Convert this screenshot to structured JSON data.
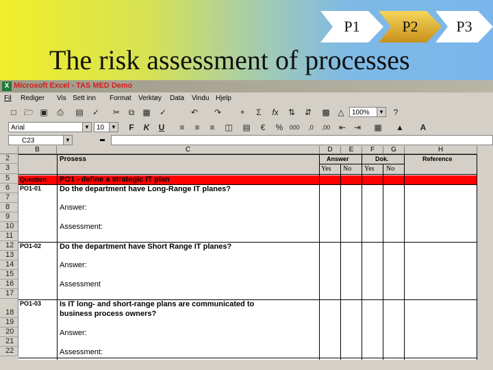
{
  "slide": {
    "title": "The risk assessment of processes",
    "steps": [
      "P1",
      "P2",
      "P3"
    ],
    "colors": {
      "chevron_plain": "#ffffff",
      "chevron_active": "#e8b82a",
      "highlight_row": "#ff0000"
    }
  },
  "excel": {
    "window_title": "Microsoft Excel - TAS MED  Demo",
    "menu": [
      "Fil",
      "Rediger",
      "Vis",
      "Sett inn",
      "Format",
      "Verktøy",
      "Data",
      "Vindu",
      "Hjelp"
    ],
    "font_name": "Arial",
    "font_size": "10",
    "zoom": "100%",
    "name_box": "C23",
    "columns": [
      "B",
      "C",
      "D",
      "E",
      "F",
      "G",
      "H"
    ],
    "rows": [
      "2",
      "3",
      "5",
      "6",
      "7",
      "8",
      "9",
      "10",
      "11",
      "12",
      "13",
      "14",
      "15",
      "16",
      "17",
      "18",
      "19",
      "20",
      "21",
      "22"
    ],
    "header": {
      "prosess": "Prosess",
      "answer": "Answer",
      "dok": "Dok.",
      "reference": "Reference",
      "yes": "Yes",
      "no": "No"
    },
    "question_label": "Question",
    "group_title": "PO1 - define a strategic IT plan",
    "items": [
      {
        "id": "PO1-01",
        "question": "Do the department have Long-Range IT planes?",
        "answer": "Answer:",
        "assessment": "Assessment:"
      },
      {
        "id": "PO1-02",
        "question": "Do the department have Short Range IT planes?",
        "answer": "Answer:",
        "assessment": "Assessment"
      },
      {
        "id": "PO1-03",
        "question": "Is IT long- and short-range plans are communicated to",
        "question2": "business process owners?",
        "answer": "Answer:",
        "assessment": "Assessment:"
      }
    ]
  }
}
